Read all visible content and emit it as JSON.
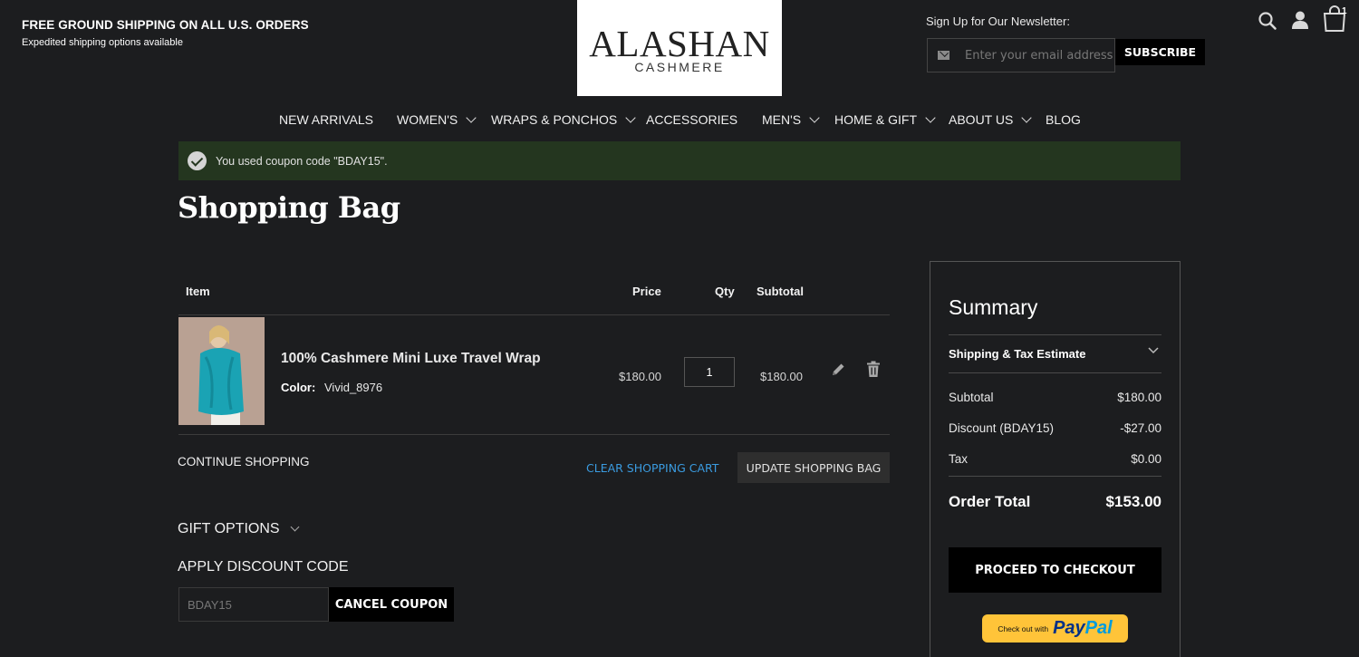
{
  "header": {
    "shipping_title": "FREE GROUND SHIPPING ON ALL U.S. ORDERS",
    "shipping_subtitle": "Expedited shipping options available",
    "logo_line1": "ALASHAN",
    "logo_line2": "CASHMERE",
    "newsletter_label": "Sign Up for Our Newsletter:",
    "newsletter_placeholder": "Enter your email address",
    "subscribe_label": "SUBSCRIBE",
    "cart_count": "1",
    "icons": [
      "search-icon",
      "account-icon",
      "cart-icon"
    ]
  },
  "nav": {
    "items": [
      {
        "label": "NEW ARRIVALS"
      },
      {
        "label": "WOMEN'S"
      },
      {
        "label": "WRAPS & PONCHOS"
      },
      {
        "label": "ACCESSORIES"
      },
      {
        "label": "MEN'S"
      },
      {
        "label": "HOME & GIFT"
      },
      {
        "label": "ABOUT US"
      },
      {
        "label": "BLOG"
      }
    ]
  },
  "message": {
    "text": "You used coupon code \"BDAY15\"."
  },
  "page_title": "Shopping Bag",
  "cart": {
    "headers": {
      "item": "Item",
      "price": "Price",
      "qty": "Qty",
      "subtotal": "Subtotal"
    },
    "items": [
      {
        "name": "100% Cashmere Mini Luxe Travel Wrap",
        "attr_label": "Color:",
        "attr_value": "Vivid_8976",
        "price": "$180.00",
        "qty": "1",
        "subtotal": "$180.00"
      }
    ],
    "continue_label": "CONTINUE SHOPPING",
    "clear_label": "CLEAR SHOPPING CART",
    "update_label": "UPDATE SHOPPING BAG"
  },
  "gift": {
    "label": "GIFT OPTIONS"
  },
  "discount": {
    "title": "APPLY DISCOUNT CODE",
    "value": "BDAY15",
    "cancel_label": "CANCEL COUPON"
  },
  "summary": {
    "title": "Summary",
    "estimate_label": "Shipping & Tax Estimate",
    "rows": [
      {
        "label": "Subtotal",
        "value": "$180.00"
      },
      {
        "label": "Discount (BDAY15)",
        "value": "-$27.00"
      },
      {
        "label": "Tax",
        "value": "$0.00"
      }
    ],
    "total_label": "Order Total",
    "total_value": "$153.00",
    "checkout_label": "PROCEED TO CHECKOUT",
    "paypal_prefix": "Check out with",
    "paypal_word1": "Pay",
    "paypal_word2": "Pal"
  },
  "colors": {
    "background": "#1c1d1f",
    "success_bar": "#24361f",
    "link": "#3a9be0",
    "paypal": "#ffc439"
  }
}
